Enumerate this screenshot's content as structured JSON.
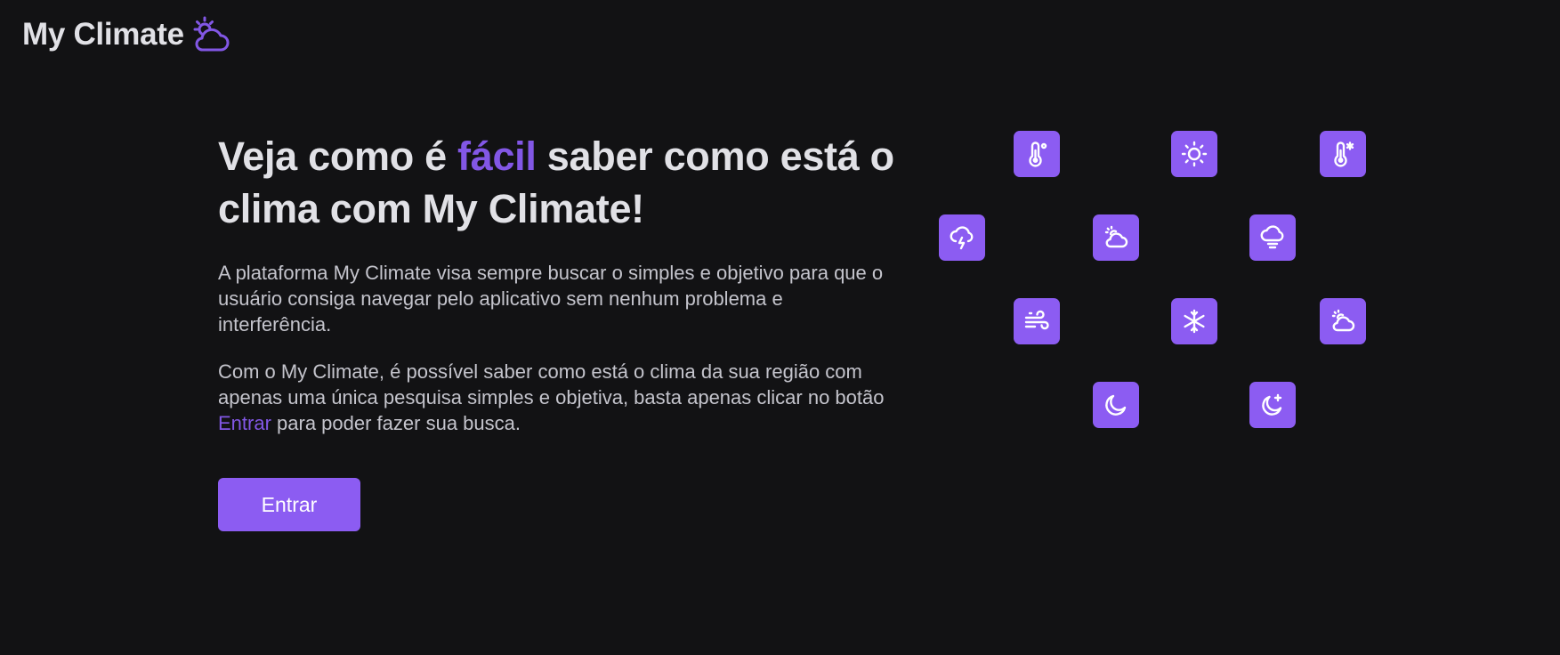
{
  "header": {
    "logo_text": "My Climate",
    "logo_icon": "sun-cloud-icon"
  },
  "hero": {
    "headline_part1": "Veja como é ",
    "headline_accent": "fácil",
    "headline_part2": " saber como está o clima com My Climate!",
    "paragraph1": "A plataforma My Climate visa sempre buscar o simples e objetivo para que o usuário consiga navegar pelo aplicativo sem nenhum problema e interferência.",
    "paragraph2_before": "Com o My Climate, é possível saber como está o clima da sua região com apenas uma única pesquisa simples e objetiva, basta apenas clicar no botão ",
    "paragraph2_link": "Entrar",
    "paragraph2_after": " para poder fazer sua busca."
  },
  "actions": {
    "enter_label": "Entrar"
  },
  "icon_grid": [
    "thermometer-celsius-icon",
    "sun-icon",
    "thermometer-snow-icon",
    "cloud-lightning-icon",
    "sun-cloud-icon",
    "cloud-fog-icon",
    "wind-icon",
    "snowflake-icon",
    "cloud-sun-icon",
    "moon-icon",
    "moon-stars-icon"
  ],
  "colors": {
    "background": "#121214",
    "accent": "#8257e5",
    "tile": "#8c5cf2",
    "text": "#e1e1e6",
    "muted_text": "#c4c4cc"
  }
}
